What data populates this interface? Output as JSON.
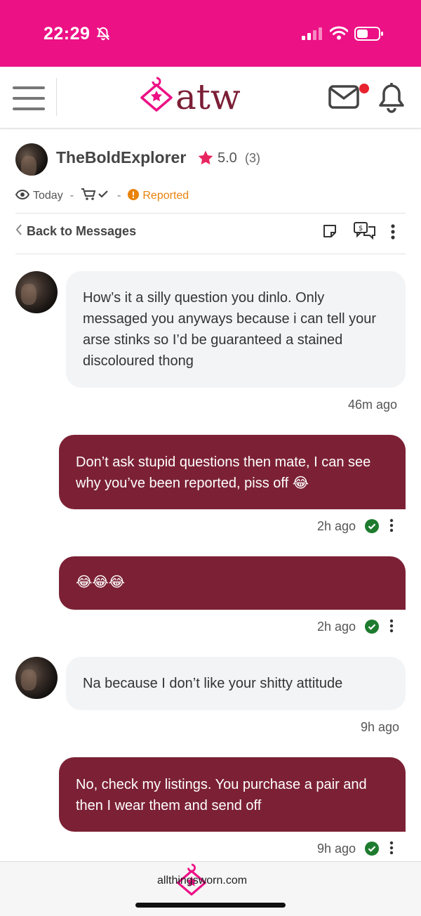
{
  "status_bar": {
    "time": "22:29"
  },
  "header": {
    "logo_text": "atw"
  },
  "profile": {
    "username": "TheBoldExplorer",
    "rating": "5.0",
    "rating_count": "(3)",
    "seen": "Today",
    "sep1": "-",
    "sep2": "-",
    "reported": "Reported"
  },
  "nav": {
    "back": "Back to Messages"
  },
  "messages": [
    {
      "direction": "in",
      "text": "How’s it a silly question you dinlo. Only messaged you anyways because i can tell your arse stinks so I’d be guaranteed a stained discoloured thong",
      "time": "46m ago"
    },
    {
      "direction": "out",
      "text": "Don’t ask stupid questions then mate, I can see why you’ve been reported, piss off 😂",
      "time": "2h ago"
    },
    {
      "direction": "out",
      "text": "😂😂😂",
      "time": "2h ago"
    },
    {
      "direction": "in",
      "text": "Na because I don’t like your shitty attitude",
      "time": "9h ago"
    },
    {
      "direction": "out",
      "text": "No, check my listings. You purchase a pair and then I wear them and send off",
      "time": "9h ago"
    }
  ],
  "footer": {
    "text": "allthingsworn.com"
  },
  "colors": {
    "brand_pink": "#ec1185",
    "bubble_out": "#7c2135",
    "bubble_in": "#f3f4f6",
    "reported": "#e9820c",
    "read_check": "#1e7b2e"
  }
}
